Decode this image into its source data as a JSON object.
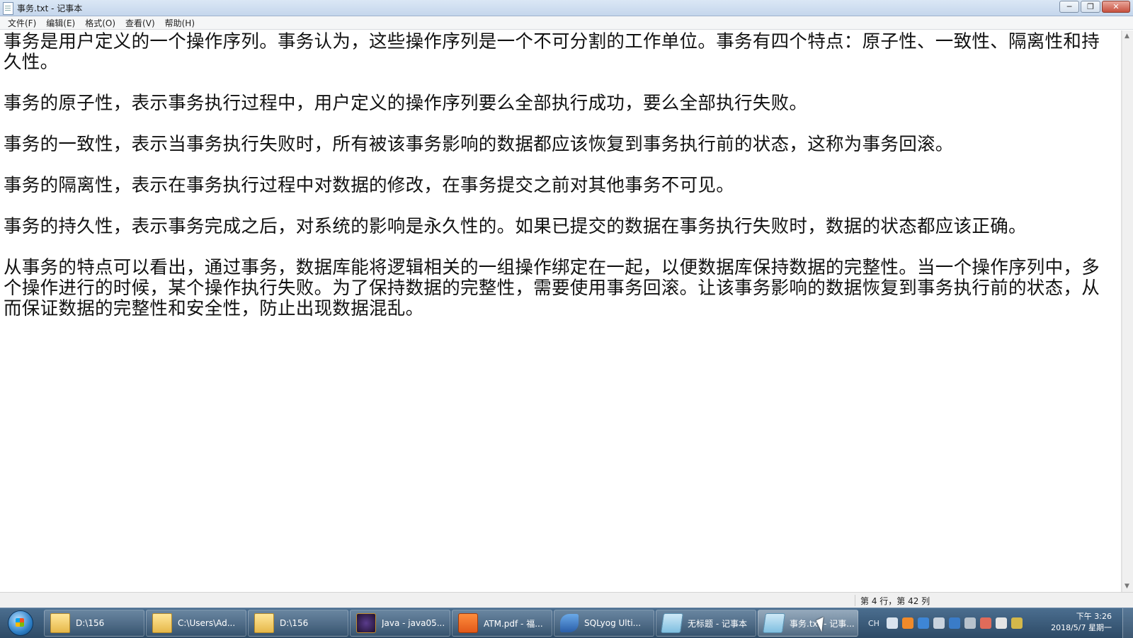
{
  "window": {
    "title": "事务.txt - 记事本",
    "controls": {
      "minimize": "─",
      "maximize": "❐",
      "close": "✕"
    }
  },
  "menu": [
    "文件(F)",
    "编辑(E)",
    "格式(O)",
    "查看(V)",
    "帮助(H)"
  ],
  "document": {
    "paragraphs": [
      "事务是用户定义的一个操作序列。事务认为，这些操作序列是一个不可分割的工作单位。事务有四个特点：原子性、一致性、隔离性和持久性。",
      "事务的原子性，表示事务执行过程中，用户定义的操作序列要么全部执行成功，要么全部执行失败。",
      "事务的一致性，表示当事务执行失败时，所有被该事务影响的数据都应该恢复到事务执行前的状态，这称为事务回滚。",
      "事务的隔离性，表示在事务执行过程中对数据的修改，在事务提交之前对其他事务不可见。",
      "事务的持久性，表示事务完成之后，对系统的影响是永久性的。如果已提交的数据在事务执行失败时，数据的状态都应该正确。",
      "从事务的特点可以看出，通过事务，数据库能将逻辑相关的一组操作绑定在一起，以便数据库保持数据的完整性。当一个操作序列中，多个操作进行的时候，某个操作执行失败。为了保持数据的完整性，需要使用事务回滚。让该事务影响的数据恢复到事务执行前的状态，从而保证数据的完整性和安全性，防止出现数据混乱。"
    ]
  },
  "statusbar": {
    "position": "第 4 行，第 42 列"
  },
  "taskbar": {
    "items": [
      {
        "label": "D:\\156",
        "icon": "folder-icon"
      },
      {
        "label": "C:\\Users\\Ad...",
        "icon": "folder-icon"
      },
      {
        "label": "D:\\156",
        "icon": "folder-icon"
      },
      {
        "label": "Java - java05...",
        "icon": "java-ide-icon"
      },
      {
        "label": "ATM.pdf - 福...",
        "icon": "pdf-icon"
      },
      {
        "label": "SQLyog Ulti...",
        "icon": "sqlyog-icon"
      },
      {
        "label": "无标题 - 记事本",
        "icon": "notepad-icon"
      },
      {
        "label": "事务.txt - 记事...",
        "icon": "notepad-icon",
        "active": true
      }
    ],
    "tray": {
      "lang": "CH"
    },
    "clock": {
      "time": "下午 3:26",
      "date": "2018/5/7 星期一"
    }
  }
}
